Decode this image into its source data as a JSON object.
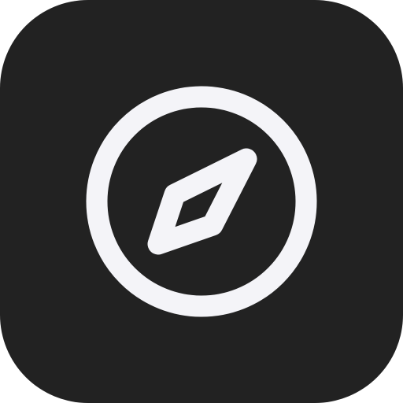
{
  "icon": {
    "name": "compass-icon",
    "background_color": "#222222",
    "glyph_color": "#F4F4F8"
  }
}
